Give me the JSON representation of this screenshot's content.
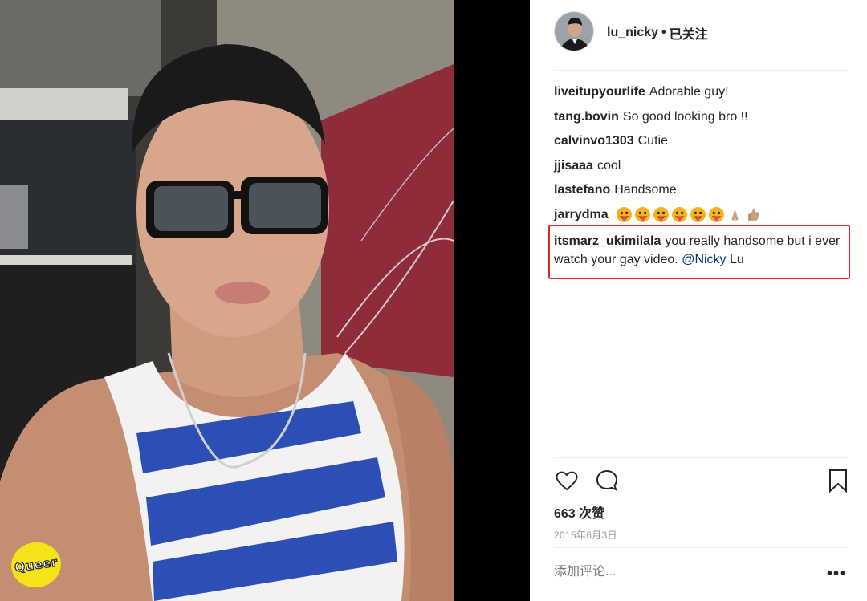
{
  "post": {
    "author": "lu_nicky",
    "separator": "•",
    "follow_status": "已关注"
  },
  "watermark": "Queer",
  "comments": [
    {
      "user": "liveitupyourlife",
      "text": "Adorable guy!"
    },
    {
      "user": "tang.bovin",
      "text": "So good looking bro !!"
    },
    {
      "user": "calvinvo1303",
      "text": "Cutie"
    },
    {
      "user": "jjisaaa",
      "text": "cool"
    },
    {
      "user": "lastefano",
      "text": "Handsome"
    },
    {
      "user": "jarrydma",
      "emojis": [
        "face-with-tongue",
        "face-with-tongue",
        "face-with-tongue",
        "face-with-tongue",
        "face-with-tongue",
        "face-with-tongue",
        "folded-hands",
        "thumbs-up"
      ]
    }
  ],
  "highlighted_comment": {
    "user": "itsmarz_ukimilala",
    "text": "you really handsome but i ever watch your gay video.",
    "mention": "@Nicky",
    "tail": "Lu"
  },
  "actions": {
    "like_icon": "heart-icon",
    "comment_icon": "speech-bubble-icon",
    "save_icon": "bookmark-icon"
  },
  "likes_label": "663 次赞",
  "date": "2015年6月3日",
  "add_comment_placeholder": "添加评论...",
  "more_label": "•••",
  "colors": {
    "highlight_border": "#e0262a",
    "mention": "#003569",
    "badge": "#f5e31a"
  }
}
